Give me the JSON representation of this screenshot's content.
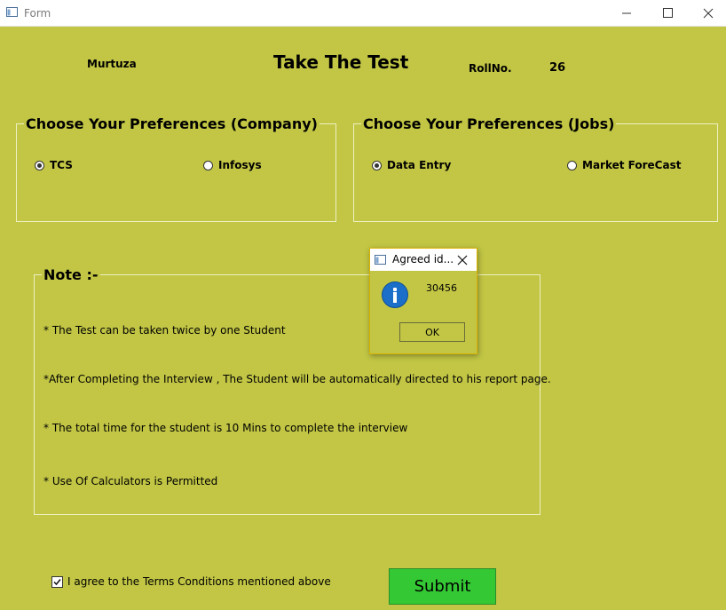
{
  "window": {
    "title": "Form"
  },
  "header": {
    "name": "Murtuza",
    "title": "Take The Test",
    "roll_label": "RollNo.",
    "roll_value": "26"
  },
  "company_group": {
    "legend": "Choose Your Preferences (Company)",
    "options": [
      {
        "label": "TCS",
        "checked": true
      },
      {
        "label": "Infosys",
        "checked": false
      }
    ]
  },
  "jobs_group": {
    "legend": "Choose Your Preferences (Jobs)",
    "options": [
      {
        "label": "Data Entry",
        "checked": true
      },
      {
        "label": "Market ForeCast",
        "checked": false
      }
    ]
  },
  "note": {
    "legend": "Note :-",
    "lines": [
      "* The Test can be taken twice by one  Student",
      "*After Completing the Interview , The Student will be automatically directed to his report page.",
      "* The total time for the student is 10 Mins to complete the interview",
      "* Use Of Calculators is Permitted"
    ]
  },
  "agree": {
    "label": "I agree to the Terms  Conditions mentioned above",
    "checked": true
  },
  "submit": {
    "label": "Submit"
  },
  "dialog": {
    "title": "Agreed id...",
    "message": "30456",
    "ok_label": "OK",
    "icon": "info-icon"
  },
  "colors": {
    "form_bg": "#c2c644",
    "submit_bg": "#34c934",
    "dialog_border": "#d9b200",
    "info_blue": "#1b6fc9"
  }
}
